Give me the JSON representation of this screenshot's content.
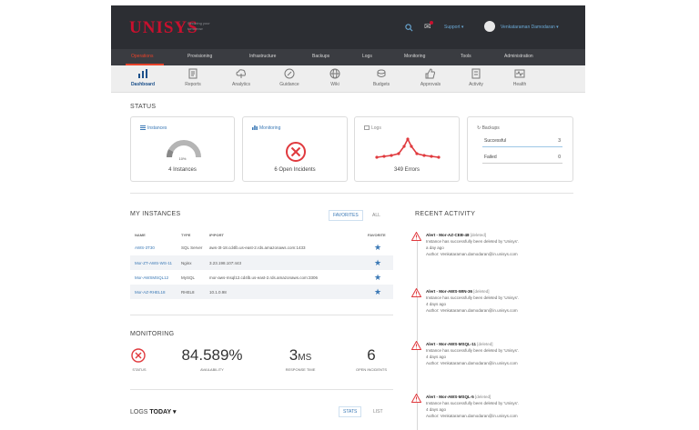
{
  "header": {
    "logo": "UNISYS",
    "tagline": "Securing your tomorrow",
    "support": "Support",
    "user": "Venkataraman Damodaran"
  },
  "main_nav": {
    "items": [
      "Operations",
      "Provisioning",
      "Infrastructure",
      "Backups",
      "Logs",
      "Monitoring",
      "Tools",
      "Administration"
    ],
    "active": "Operations"
  },
  "sub_nav": {
    "items": [
      "Dashboard",
      "Reports",
      "Analytics",
      "Guidance",
      "Wiki",
      "Budgets",
      "Approvals",
      "Activity",
      "Health"
    ],
    "active": "Dashboard"
  },
  "status": {
    "title": "STATUS",
    "instances": {
      "title": "Instances",
      "gauge_label": "10%",
      "gauge_fraction": 0.1,
      "caption": "4 Instances"
    },
    "monitoring": {
      "title": "Monitoring",
      "caption": "6 Open Incidents"
    },
    "logs": {
      "title": "Logs",
      "caption": "349 Errors"
    },
    "backups": {
      "title": "Backups",
      "rows": [
        {
          "label": "Successful",
          "value": "3"
        },
        {
          "label": "Failed",
          "value": "0"
        }
      ]
    }
  },
  "instances": {
    "title": "MY INSTANCES",
    "toggle": {
      "favorites": "FAVORITES",
      "all": "ALL"
    },
    "columns": [
      "NAME",
      "TYPE",
      "IP/PORT",
      "FAVORITE"
    ],
    "rows": [
      {
        "name": "AWS-3T30",
        "type": "SQL Server",
        "ip": "aws-3t-18.cd4lb.us-east-2.rds.amazonaws.com:1433"
      },
      {
        "name": "Mor-ZT-AWS-WS-11",
        "type": "Nginx",
        "ip": "3.23.198.107:443"
      },
      {
        "name": "Mor-AWSMSQL12",
        "type": "MySQL",
        "ip": "mor-aws-msql12.cd4lb.us-east-2.rds.amazonaws.com:3306"
      },
      {
        "name": "Mor-AZ-RHEL18",
        "type": "RHEL8",
        "ip": "10.1.0.98"
      }
    ]
  },
  "monitoring": {
    "title": "MONITORING",
    "metrics": [
      {
        "value": "84.589%",
        "label": "AVAILABILITY"
      },
      {
        "value": "3",
        "unit": "MS",
        "label": "RESPONSE TIME"
      },
      {
        "value": "6",
        "label": "OPEN INCIDENTS"
      }
    ],
    "status_label": "STATUS"
  },
  "logs": {
    "title": "LOGS",
    "range": "TODAY",
    "toggle": {
      "stats": "STATS",
      "list": "LIST"
    }
  },
  "recent_activity": {
    "title": "RECENT ACTIVITY",
    "alerts": [
      {
        "name": "Alert - Mor-AZ-CEB-48",
        "tag": "[deleted]",
        "text": "Instance has successfully been deleted by 'Unisys'.",
        "age": "a day ago",
        "author": "Author: Venkataraman.damodaran@in.unisys.com"
      },
      {
        "name": "Alert - Mor-AWS-WIN-36",
        "tag": "[deleted]",
        "text": "Instance has successfully been deleted by 'Unisys'.",
        "age": "4 days ago",
        "author": "Author: Venkataraman.damodaran@in.unisys.com"
      },
      {
        "name": "Alert - Mor-AWS-MSQL-11",
        "tag": "[deleted]",
        "text": "Instance has successfully been deleted by 'Unisys'.",
        "age": "4 days ago",
        "author": "Author: Venkataraman.damodaran@in.unisys.com"
      },
      {
        "name": "Alert - Mor-AWS-MSQL-5",
        "tag": "[deleted]",
        "text": "Instance has successfully been deleted by 'Unisys'.",
        "age": "4 days ago",
        "author": "Author: Venkataraman.damodaran@in.unisys.com"
      }
    ]
  },
  "colors": {
    "brand_red": "#c8102e",
    "accent_blue": "#3a78b5",
    "alert_red": "#e03a3e"
  },
  "icons": [
    "search-icon",
    "bell-icon",
    "dashboard-icon",
    "reports-icon",
    "analytics-icon",
    "guidance-icon",
    "wiki-icon",
    "budgets-icon",
    "approvals-icon",
    "activity-icon",
    "health-icon",
    "star-icon",
    "x-circle-icon",
    "alert-triangle-icon",
    "backup-icon",
    "chevron-down-icon"
  ]
}
